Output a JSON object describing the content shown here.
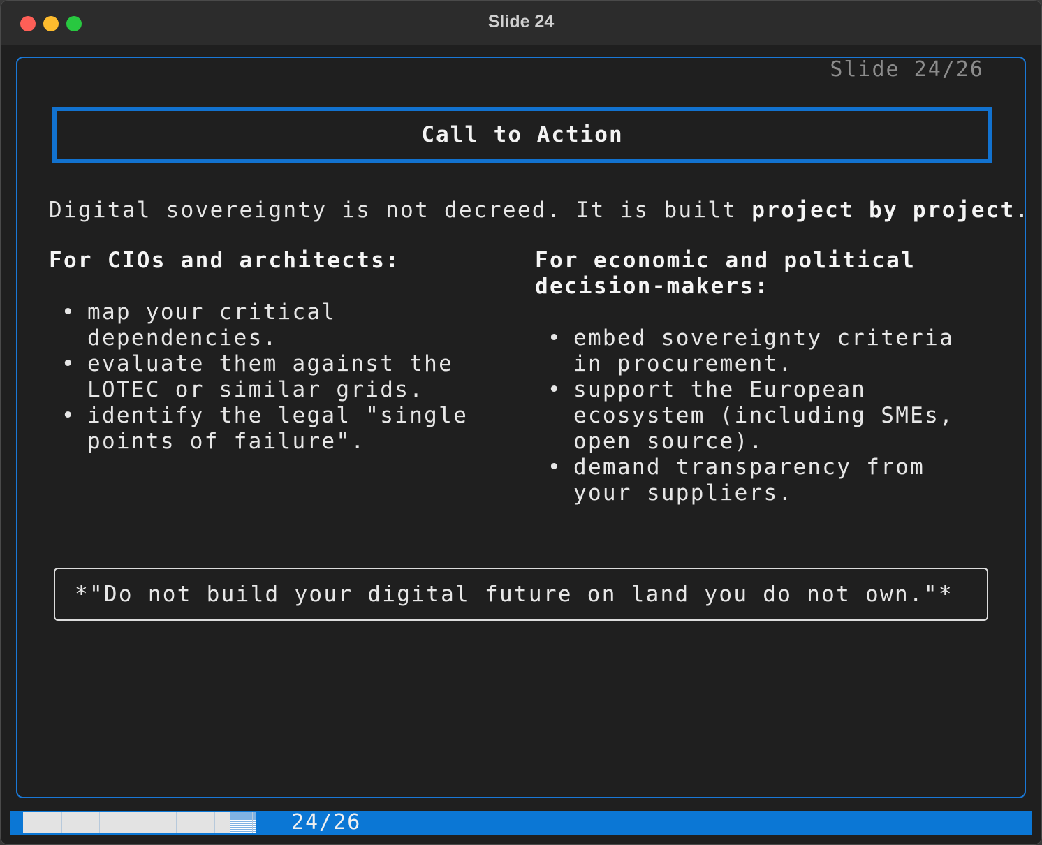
{
  "window": {
    "title": "Slide 24"
  },
  "slide": {
    "counter": "Slide 24/26",
    "heading": "Call to Action",
    "intro_plain": "Digital sovereignty is not decreed. It is built ",
    "intro_bold": "project by project",
    "intro_end": ".",
    "left": {
      "title": "For CIOs and architects:",
      "items": [
        "map your critical dependencies.",
        "evaluate them against the LOTEC or similar grids.",
        "identify the legal \"single points of failure\"."
      ]
    },
    "right": {
      "title": "For economic and political decision-makers:",
      "items": [
        "embed sovereignty criteria in procurement.",
        "support the European ecosystem (including SMEs, open source).",
        "demand transparency from your suppliers."
      ]
    },
    "quote": "*\"Do not build your digital future on land you do not own.\"*"
  },
  "status": {
    "progress_label": "24/26",
    "current": 24,
    "total": 26
  },
  "colors": {
    "accent": "#1272cf",
    "statusbar": "#0b77d5",
    "background": "#1f1f1f"
  }
}
